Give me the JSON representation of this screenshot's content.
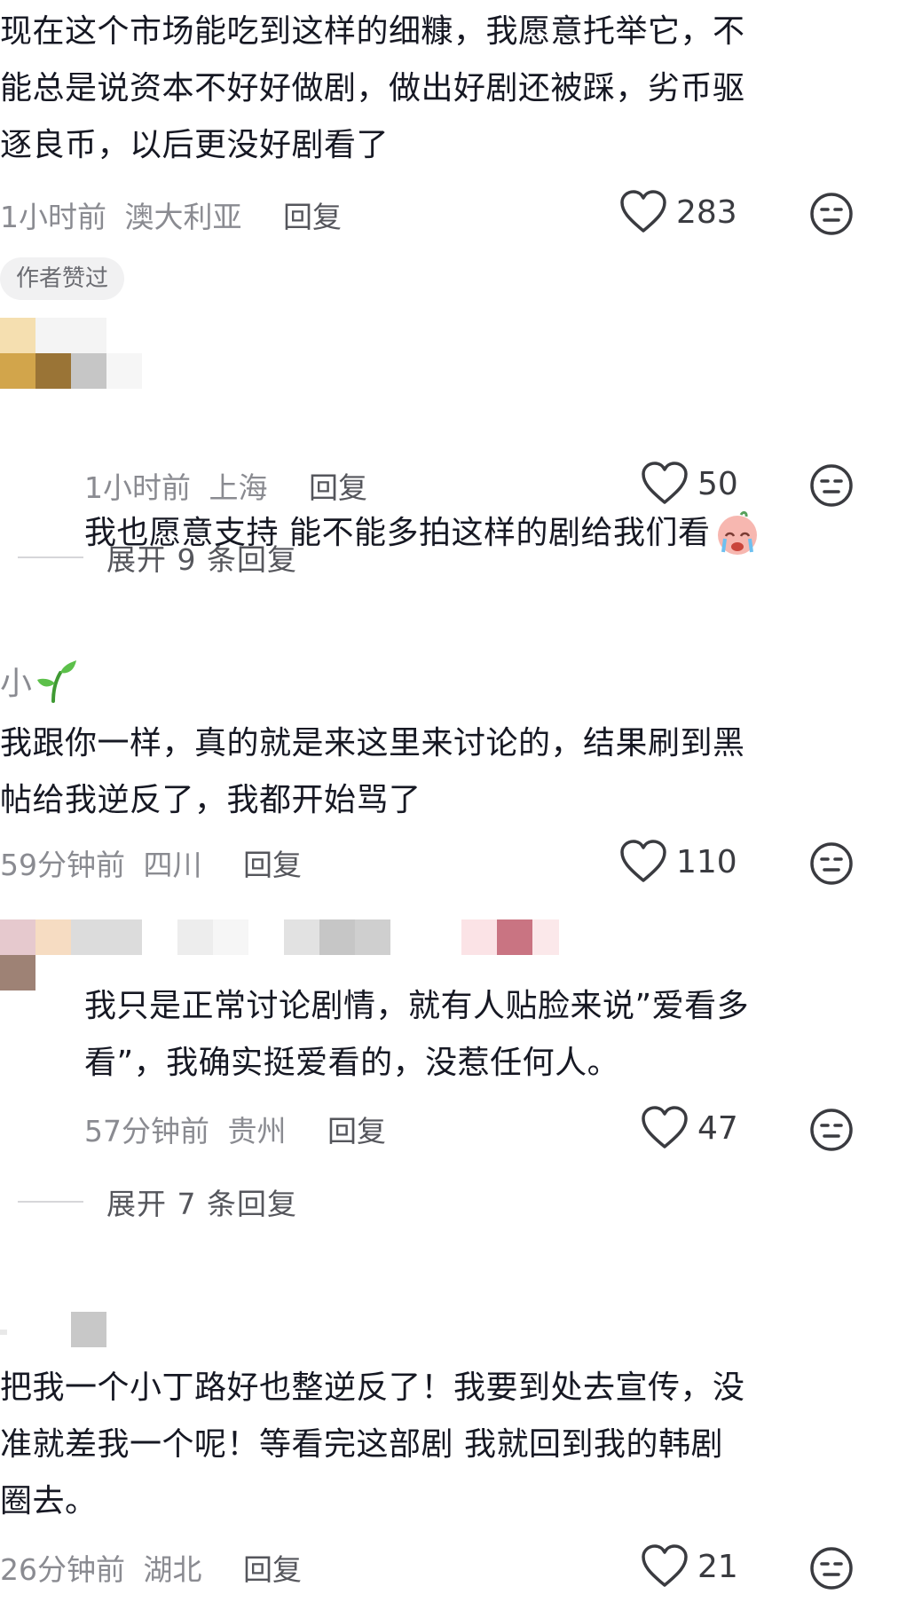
{
  "comments": [
    {
      "text": "现在这个市场能吃到这样的细糠，我愿意托举它，不\n能总是说资本不好好做剧，做出好剧还被踩，劣币驱\n逐良币，以后更没好剧看了",
      "time": "1小时前",
      "location": "澳大利亚",
      "reply_label": "回复",
      "likes": "283"
    },
    {
      "badge": "作者赞过",
      "text": "我也愿意支持 能不能多拍这样的剧给我们看",
      "emoji": "crying-face-emoji",
      "time": "1小时前",
      "location": "上海",
      "reply_label": "回复",
      "likes": "50",
      "expand_label": "展开 9 条回复"
    },
    {
      "username": "小",
      "text": "我跟你一样，真的就是来这里来讨论的，结果刷到黑\n帖给我逆反了，我都开始骂了",
      "time": "59分钟前",
      "location": "四川",
      "reply_label": "回复",
      "likes": "110"
    },
    {
      "text": "我只是正常讨论剧情，就有人贴脸来说”爱看多\n看”，我确实挺爱看的，没惹任何人。",
      "time": "57分钟前",
      "location": "贵州",
      "reply_label": "回复",
      "likes": "47",
      "expand_label": "展开 7 条回复"
    },
    {
      "text": "把我一个小丁路好也整逆反了！我要到处去宣传，没\n准就差我一个呢！等看完这部剧 我就回到我的韩剧\n圈去。",
      "time": "26分钟前",
      "location": "湖北",
      "reply_label": "回复",
      "likes": "21"
    }
  ],
  "icons": {
    "like": "heart-outline-icon",
    "dislike": "meh-face-icon",
    "sprout": "seedling-icon"
  },
  "colors": {
    "text": "#161823",
    "meta": "#8a8b91",
    "icon": "#3a3b40"
  }
}
